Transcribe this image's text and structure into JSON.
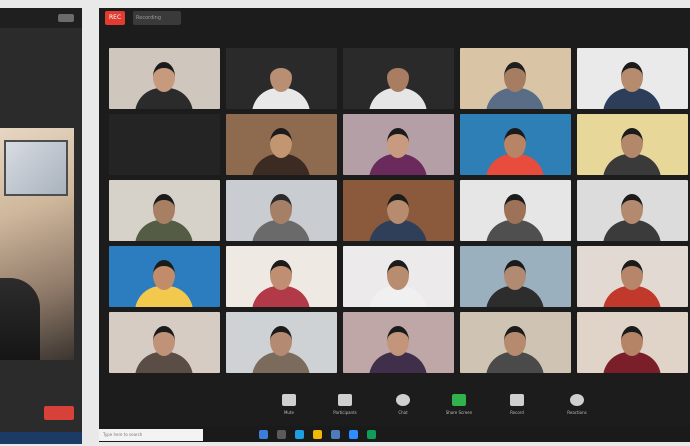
{
  "meeting": {
    "record_label": "REC",
    "top_label": "Recording",
    "participants": [
      {
        "name": "",
        "bg": "#cfc6bd",
        "skin": "#c79a7d",
        "shirt": "#2b2b2b",
        "hair": "#1b1b1b"
      },
      {
        "name": "",
        "bg": "#2a2a2a",
        "skin": "#b98f73",
        "shirt": "#e8e8e8",
        "hair": "#2b2b2b"
      },
      {
        "name": "",
        "bg": "#2a2a2a",
        "skin": "#a87d62",
        "shirt": "#e6e6e6",
        "hair": "#2b2b2b"
      },
      {
        "name": "",
        "bg": "#d9c5a6",
        "skin": "#a67d60",
        "shirt": "#5a6d86",
        "hair": "#1f1f1f"
      },
      {
        "name": "",
        "bg": "#eaeaea",
        "skin": "#b78b6e",
        "shirt": "#2d3e5a",
        "hair": "#1b1b1b"
      },
      {
        "name": "",
        "bg": "#242424",
        "skin": "",
        "shirt": "",
        "hair": "",
        "text_only": true
      },
      {
        "name": "",
        "bg": "#8e6a4f",
        "skin": "#c39672",
        "shirt": "#3b2b22",
        "hair": "#1b1b1b"
      },
      {
        "name": "",
        "bg": "#b59fa6",
        "skin": "#c89a80",
        "shirt": "#6a2b5c",
        "hair": "#1b1b1b"
      },
      {
        "name": "",
        "bg": "#2f7fb7",
        "skin": "#b78466",
        "shirt": "#e74c3c",
        "hair": "#1b1b1b"
      },
      {
        "name": "",
        "bg": "#e7d89a",
        "skin": "#b3876a",
        "shirt": "#3a3a3a",
        "hair": "#1b1b1b"
      },
      {
        "name": "",
        "bg": "#d7d2c9",
        "skin": "#a97f63",
        "shirt": "#555c45",
        "hair": "#1b1b1b"
      },
      {
        "name": "",
        "bg": "#c9ccd0",
        "skin": "#a67f67",
        "shirt": "#6a6a6a",
        "hair": "#2a2a2a"
      },
      {
        "name": "",
        "bg": "#8b5a3c",
        "skin": "#b78b6d",
        "shirt": "#2f3f5a",
        "hair": "#1b1b1b"
      },
      {
        "name": "",
        "bg": "#e6e6e6",
        "skin": "#9e7258",
        "shirt": "#4f4f4f",
        "hair": "#1b1b1b"
      },
      {
        "name": "",
        "bg": "#dcdcdc",
        "skin": "#b38a6e",
        "shirt": "#3b3b3b",
        "hair": "#1b1b1b"
      },
      {
        "name": "",
        "bg": "#2c7cc0",
        "skin": "#c18c6a",
        "shirt": "#f2c94c",
        "hair": "#1b1b1b"
      },
      {
        "name": "",
        "bg": "#efe9e3",
        "skin": "#c08f73",
        "shirt": "#b23a48",
        "hair": "#1b1b1b"
      },
      {
        "name": "",
        "bg": "#eceaea",
        "skin": "#b78c6f",
        "shirt": "#f0f0f0",
        "hair": "#1b1b1b"
      },
      {
        "name": "",
        "bg": "#9ab0bf",
        "skin": "#b18a72",
        "shirt": "#2d2d2d",
        "hair": "#1b1b1b"
      },
      {
        "name": "",
        "bg": "#e3d9d3",
        "skin": "#b7866a",
        "shirt": "#c0392b",
        "hair": "#1b1b1b"
      },
      {
        "name": "",
        "bg": "#d6ccc4",
        "skin": "#c09378",
        "shirt": "#5a4d45",
        "hair": "#1b1b1b"
      },
      {
        "name": "",
        "bg": "#cfd2d4",
        "skin": "#b48b70",
        "shirt": "#7a6b5c",
        "hair": "#1b1b1b"
      },
      {
        "name": "",
        "bg": "#bfa7a7",
        "skin": "#c3967b",
        "shirt": "#3f2f4a",
        "hair": "#1b1b1b"
      },
      {
        "name": "",
        "bg": "#cfc4b4",
        "skin": "#b58a6d",
        "shirt": "#4a4a4a",
        "hair": "#1b1b1b"
      },
      {
        "name": "",
        "bg": "#e0d3c8",
        "skin": "#b58467",
        "shirt": "#7a1f2a",
        "hair": "#1b1b1b"
      }
    ]
  },
  "controls": [
    {
      "key": "mute",
      "label": "Mute",
      "icon": "microphone-icon",
      "color": "#cfcfcf"
    },
    {
      "key": "participants",
      "label": "Participants",
      "icon": "participants-icon",
      "color": "#cfcfcf"
    },
    {
      "key": "chat",
      "label": "Chat",
      "icon": "chat-icon",
      "color": "#cfcfcf"
    },
    {
      "key": "share",
      "label": "Share Screen",
      "icon": "share-screen-icon",
      "color": "#2fb24c"
    },
    {
      "key": "record",
      "label": "Record",
      "icon": "record-icon",
      "color": "#cfcfcf"
    },
    {
      "key": "reactions",
      "label": "Reactions",
      "icon": "reactions-icon",
      "color": "#cfcfcf"
    }
  ],
  "taskbar": {
    "search_placeholder": "Type here to search"
  }
}
